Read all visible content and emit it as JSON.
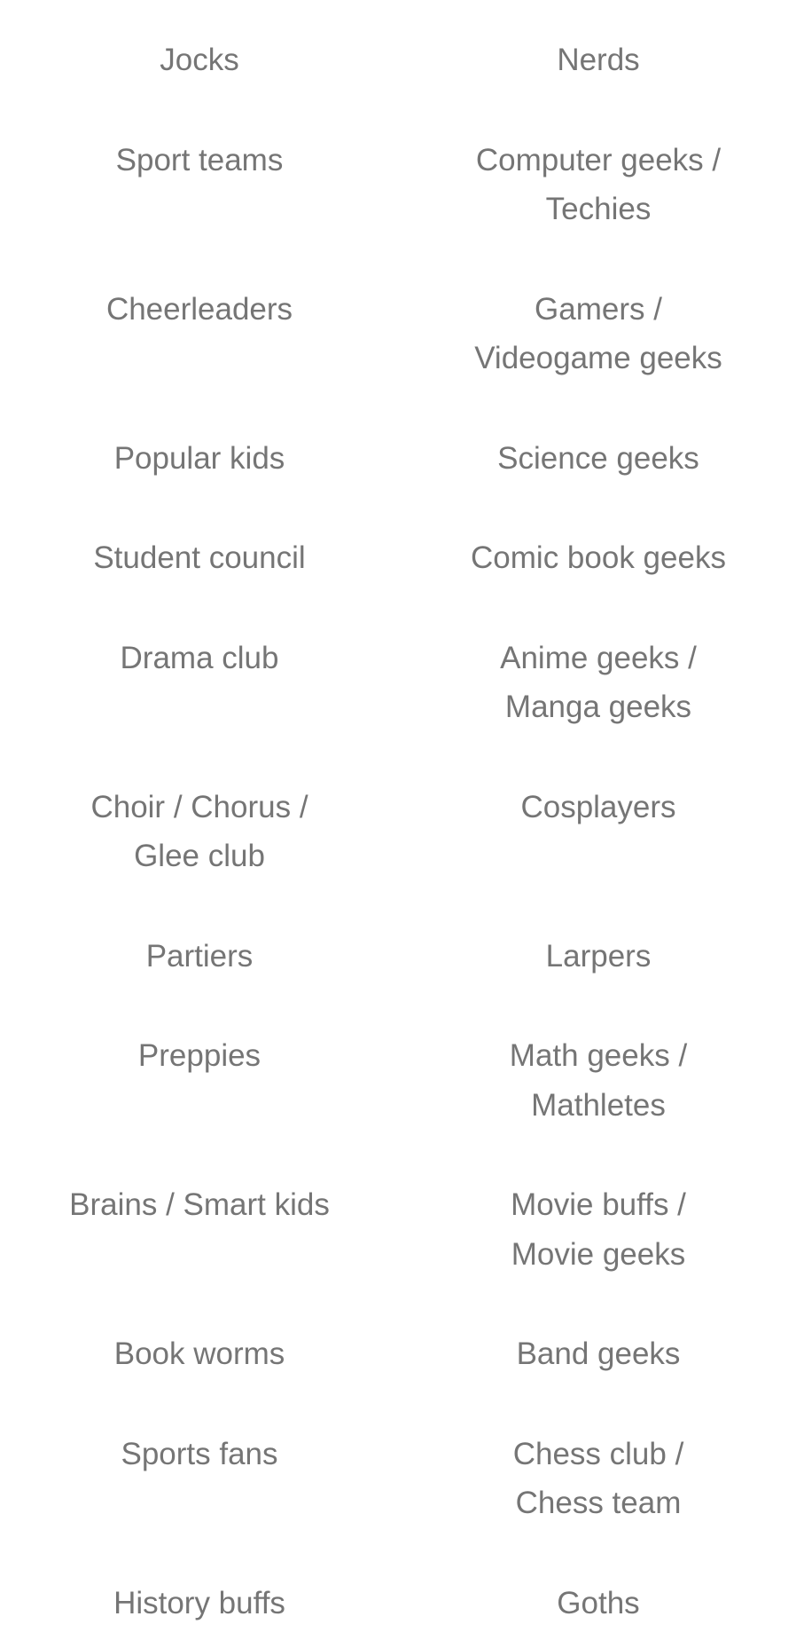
{
  "text_color": "#757575",
  "rows": [
    {
      "left": [
        "Jocks"
      ],
      "right": [
        "Nerds"
      ]
    },
    {
      "left": [
        "Sport teams"
      ],
      "right": [
        "Computer geeks /",
        "Techies"
      ]
    },
    {
      "left": [
        "Cheerleaders"
      ],
      "right": [
        "Gamers /",
        "Videogame geeks"
      ]
    },
    {
      "left": [
        "Popular kids"
      ],
      "right": [
        "Science geeks"
      ]
    },
    {
      "left": [
        "Student council"
      ],
      "right": [
        "Comic book geeks"
      ]
    },
    {
      "left": [
        "Drama club"
      ],
      "right": [
        "Anime geeks /",
        "Manga geeks"
      ]
    },
    {
      "left": [
        "Choir / Chorus /",
        "Glee club"
      ],
      "right": [
        "Cosplayers"
      ]
    },
    {
      "left": [
        "Partiers"
      ],
      "right": [
        "Larpers"
      ]
    },
    {
      "left": [
        "Preppies"
      ],
      "right": [
        "Math geeks /",
        "Mathletes"
      ]
    },
    {
      "left": [
        "Brains / Smart kids"
      ],
      "right": [
        "Movie buffs /",
        "Movie geeks"
      ]
    },
    {
      "left": [
        "Book worms"
      ],
      "right": [
        "Band geeks"
      ]
    },
    {
      "left": [
        "Sports fans"
      ],
      "right": [
        "Chess club /",
        "Chess team"
      ]
    },
    {
      "left": [
        "History buffs"
      ],
      "right": [
        "Goths"
      ]
    }
  ]
}
